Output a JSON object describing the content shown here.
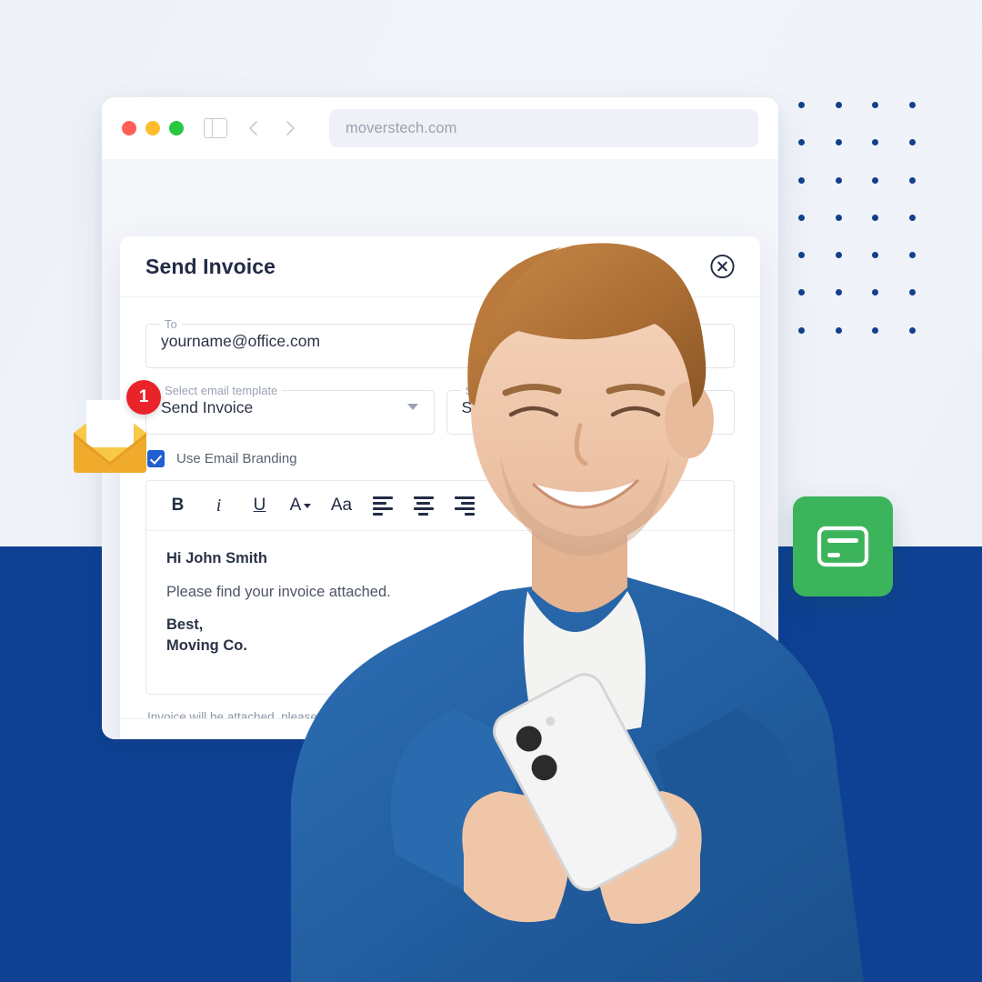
{
  "background": {
    "top_color": "#eff2f7",
    "bottom_band_color": "#0e4194",
    "dot_color": "#12408c",
    "dot_rows": 7,
    "dot_cols": 4
  },
  "browser": {
    "traffic_lights": [
      {
        "name": "close",
        "color": "#ff5f57"
      },
      {
        "name": "minimize",
        "color": "#ffbd2e"
      },
      {
        "name": "zoom",
        "color": "#28c840"
      }
    ],
    "sidebar_toggle_icon": "sidebar-icon",
    "back_icon": "chevron-left-icon",
    "forward_icon": "chevron-right-icon",
    "url": "moverstech.com"
  },
  "modal": {
    "title": "Send Invoice",
    "close_icon": "close-circle-icon",
    "fields": {
      "to": {
        "label": "To",
        "value": "yourname@office.com"
      },
      "template": {
        "label": "Select email template",
        "value": "Send Invoice",
        "caret_icon": "chevron-down-icon"
      },
      "subject": {
        "label": "Subject",
        "value": "Send Invoice"
      }
    },
    "branding": {
      "label": "Use Email Branding",
      "checked": true,
      "color": "#1f5fd0"
    },
    "toolbar": [
      {
        "name": "bold-button",
        "label": "B"
      },
      {
        "name": "italic-button",
        "label": "i"
      },
      {
        "name": "underline-button",
        "label": "U"
      },
      {
        "name": "text-color-button",
        "label": "A"
      },
      {
        "name": "font-size-button",
        "label": "Aa"
      },
      {
        "name": "align-left-button",
        "label": ""
      },
      {
        "name": "align-center-button",
        "label": ""
      },
      {
        "name": "align-right-button",
        "label": ""
      }
    ],
    "body": {
      "greeting": "Hi John Smith",
      "message": "Please find your invoice attached.",
      "signoff": "Best,",
      "company": "Moving Co."
    },
    "helper_text": "Invoice will be attached, please a"
  },
  "floating": {
    "mail_icon": {
      "name": "mail-open-icon",
      "badge": "1",
      "badge_color": "#e8242a",
      "color": "#f5b826"
    },
    "card_icon": {
      "name": "credit-card-icon",
      "tile_color": "#3cb45b"
    }
  }
}
